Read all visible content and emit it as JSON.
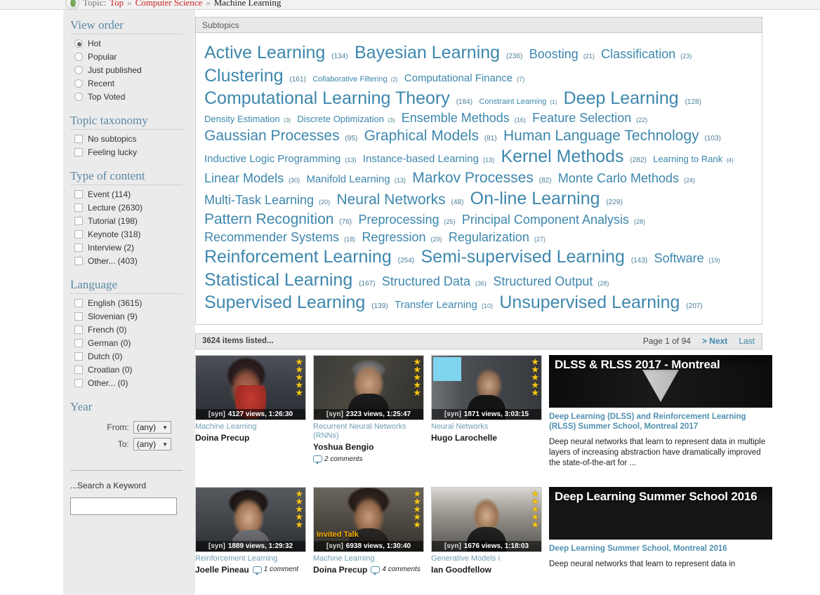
{
  "breadcrumb": {
    "label": "Topic:",
    "top": "Top",
    "sep1": "»",
    "computer_science": "Computer Science",
    "sep2": "»",
    "current": "Machine Learning"
  },
  "sidebar": {
    "view_order": {
      "heading": "View order",
      "options": [
        {
          "label": "Hot",
          "selected": true
        },
        {
          "label": "Popular",
          "selected": false
        },
        {
          "label": "Just published",
          "selected": false
        },
        {
          "label": "Recent",
          "selected": false
        },
        {
          "label": "Top Voted",
          "selected": false
        }
      ]
    },
    "topic_taxonomy": {
      "heading": "Topic taxonomy",
      "options": [
        {
          "label": "No subtopics",
          "checked": false
        },
        {
          "label": "Feeling lucky",
          "checked": false
        }
      ]
    },
    "type_of_content": {
      "heading": "Type of content",
      "options": [
        {
          "label": "Event (114)",
          "checked": false
        },
        {
          "label": "Lecture (2630)",
          "checked": false
        },
        {
          "label": "Tutorial (198)",
          "checked": false
        },
        {
          "label": "Keynote (318)",
          "checked": false
        },
        {
          "label": "Interview (2)",
          "checked": false
        },
        {
          "label": "Other... (403)",
          "checked": false
        }
      ]
    },
    "language": {
      "heading": "Language",
      "options": [
        {
          "label": "English (3615)",
          "checked": false
        },
        {
          "label": "Slovenian (9)",
          "checked": false
        },
        {
          "label": "French (0)",
          "checked": false
        },
        {
          "label": "German (0)",
          "checked": false
        },
        {
          "label": "Dutch (0)",
          "checked": false
        },
        {
          "label": "Croatian (0)",
          "checked": false
        },
        {
          "label": "Other... (0)",
          "checked": false
        }
      ]
    },
    "year": {
      "heading": "Year",
      "from_label": "From:",
      "from_value": "(any)",
      "to_label": "To:",
      "to_value": "(any)"
    },
    "search": {
      "label": "...Search a Keyword",
      "value": "",
      "placeholder": ""
    }
  },
  "main": {
    "subtopics_header": "Subtopics",
    "tags": [
      {
        "name": "Active Learning",
        "count": "(134)",
        "size": "s6"
      },
      {
        "name": "Bayesian Learning",
        "count": "(236)",
        "size": "s6"
      },
      {
        "name": "Boosting",
        "count": "(21)",
        "size": "s4"
      },
      {
        "name": "Classification",
        "count": "(23)",
        "size": "s4"
      },
      {
        "name": "Clustering",
        "count": "(161)",
        "size": "s6"
      },
      {
        "name": "Collaborative Filtering",
        "count": "(2)",
        "size": "s1"
      },
      {
        "name": "Computational Finance",
        "count": "(7)",
        "size": "s3"
      },
      {
        "name": "Computational Learning Theory",
        "count": "(184)",
        "size": "s6"
      },
      {
        "name": "Constraint Learning",
        "count": "(1)",
        "size": "s1"
      },
      {
        "name": "Deep Learning",
        "count": "(128)",
        "size": "s6"
      },
      {
        "name": "Density Estimation",
        "count": "(3)",
        "size": "s2"
      },
      {
        "name": "Discrete Optimization",
        "count": "(3)",
        "size": "s2"
      },
      {
        "name": "Ensemble Methods",
        "count": "(16)",
        "size": "s4"
      },
      {
        "name": "Feature Selection",
        "count": "(22)",
        "size": "s4"
      },
      {
        "name": "Gaussian Processes",
        "count": "(95)",
        "size": "s5"
      },
      {
        "name": "Graphical Models",
        "count": "(81)",
        "size": "s5"
      },
      {
        "name": "Human Language Technology",
        "count": "(103)",
        "size": "s5"
      },
      {
        "name": "Inductive Logic Programming",
        "count": "(13)",
        "size": "s3"
      },
      {
        "name": "Instance-based Learning",
        "count": "(13)",
        "size": "s3"
      },
      {
        "name": "Kernel Methods",
        "count": "(282)",
        "size": "s6"
      },
      {
        "name": "Learning to Rank",
        "count": "(4)",
        "size": "s2"
      },
      {
        "name": "Linear Models",
        "count": "(30)",
        "size": "s4"
      },
      {
        "name": "Manifold Learning",
        "count": "(13)",
        "size": "s3"
      },
      {
        "name": "Markov Processes",
        "count": "(82)",
        "size": "s5"
      },
      {
        "name": "Monte Carlo Methods",
        "count": "(24)",
        "size": "s4"
      },
      {
        "name": "Multi-Task Learning",
        "count": "(20)",
        "size": "s4"
      },
      {
        "name": "Neural Networks",
        "count": "(48)",
        "size": "s5"
      },
      {
        "name": "On-line Learning",
        "count": "(229)",
        "size": "s6"
      },
      {
        "name": "Pattern Recognition",
        "count": "(76)",
        "size": "s5"
      },
      {
        "name": "Preprocessing",
        "count": "(25)",
        "size": "s4"
      },
      {
        "name": "Principal Component Analysis",
        "count": "(28)",
        "size": "s4"
      },
      {
        "name": "Recommender Systems",
        "count": "(18)",
        "size": "s4"
      },
      {
        "name": "Regression",
        "count": "(29)",
        "size": "s4"
      },
      {
        "name": "Regularization",
        "count": "(27)",
        "size": "s4"
      },
      {
        "name": "Reinforcement Learning",
        "count": "(254)",
        "size": "s6"
      },
      {
        "name": "Semi-supervised Learning",
        "count": "(143)",
        "size": "s6"
      },
      {
        "name": "Software",
        "count": "(19)",
        "size": "s4"
      },
      {
        "name": "Statistical Learning",
        "count": "(167)",
        "size": "s6"
      },
      {
        "name": "Structured Data",
        "count": "(36)",
        "size": "s4"
      },
      {
        "name": "Structured Output",
        "count": "(28)",
        "size": "s4"
      },
      {
        "name": "Supervised Learning",
        "count": "(139)",
        "size": "s6"
      },
      {
        "name": "Transfer Learning",
        "count": "(10)",
        "size": "s3"
      },
      {
        "name": "Unsupervised Learning",
        "count": "(207)",
        "size": "s6"
      }
    ],
    "results_header": {
      "count_text": "3624 items listed...",
      "page_text": "Page 1 of 94",
      "next_label": "> Next",
      "last_label": "Last"
    },
    "rows": [
      {
        "videos": [
          {
            "topic": "Machine Learning",
            "author": "Doina Precup",
            "syn": "[syn]",
            "meta": "4127 views, 1:26:30",
            "stars": 5,
            "comments": "",
            "badge": "",
            "scene": "sc-precup"
          },
          {
            "topic": "Recurrent Neural Networks (RNNs)",
            "author": "Yoshua Bengio",
            "syn": "[syn]",
            "meta": "2323 views, 1:25:47",
            "stars": 5,
            "comments": "2 comments",
            "badge": "",
            "scene": "sc-bengio"
          },
          {
            "topic": "Neural Networks",
            "author": "Hugo Larochelle",
            "syn": "[syn]",
            "meta": "1871 views, 3:03:15",
            "stars": 5,
            "comments": "",
            "badge": "",
            "scene": "sc-larochelle"
          }
        ],
        "feature": {
          "banner_title": "DLSS & RLSS 2017 - Montreal",
          "title": "Deep Learning (DLSS) and Reinforcement Learning (RLSS) Summer School, Montreal 2017",
          "description": "Deep neural networks that learn to represent data in multiple layers of increasing abstraction have dramatically improved the state-of-the-art for ...",
          "scene": "sc-dlss"
        }
      },
      {
        "videos": [
          {
            "topic": "Reinforcement Learning",
            "author": "Joelle Pineau",
            "syn": "[syn]",
            "meta": "1889 views, 1:29:32",
            "stars": 5,
            "comments": "1 comment",
            "badge": "",
            "scene": "sc-pineau"
          },
          {
            "topic": "Machine Learning",
            "author": "Doina Precup",
            "syn": "[syn]",
            "meta": "6938 views, 1:30:40",
            "stars": 5,
            "comments": "4 comments",
            "badge": "Invited Talk",
            "scene": "sc-precup2"
          },
          {
            "topic": "Generative Models I",
            "author": "Ian Goodfellow",
            "syn": "[syn]",
            "meta": "1676 views, 1:18:03",
            "stars": 5,
            "comments": "",
            "badge": "",
            "scene": "sc-goodfellow"
          }
        ],
        "feature": {
          "banner_title": "Deep Learning Summer School 2016",
          "title": "Deep Learning Summer School, Montreal 2016",
          "description": "Deep neural networks that learn to represent data in",
          "scene": "sc-dlss2"
        }
      }
    ]
  }
}
